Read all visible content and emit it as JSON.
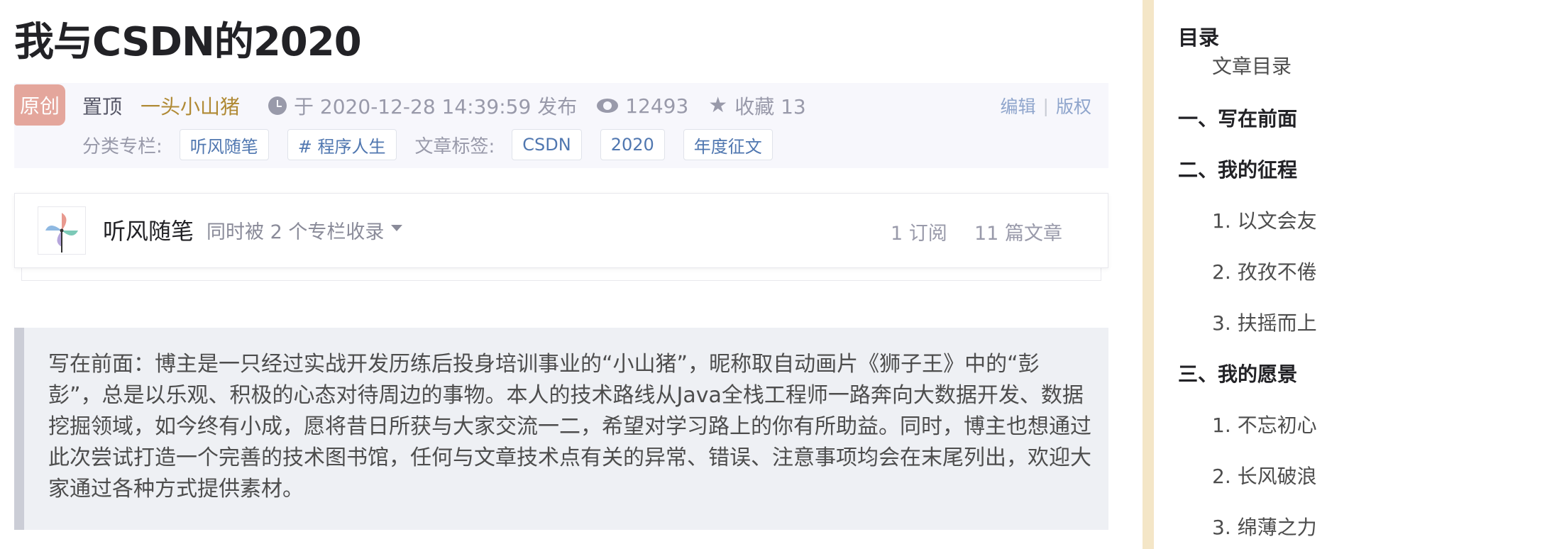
{
  "article": {
    "title": "我与CSDN的2020",
    "original_badge": "原创",
    "pinned": "置顶",
    "author": "一头小山猪",
    "publish_text": "于 2020-12-28 14:39:59 发布",
    "views": "12493",
    "favorites_text": "收藏 13",
    "edit_label": "编辑",
    "copyright_label": "版权",
    "category_label": "分类专栏:",
    "categories": [
      "听风随笔",
      "# 程序人生"
    ],
    "tags_label": "文章标签:",
    "tags": [
      "CSDN",
      "2020",
      "年度征文"
    ]
  },
  "column_card": {
    "name": "听风随笔",
    "also_included": "同时被 2 个专栏收录",
    "subscribers": "1 订阅",
    "article_count": "11 篇文章"
  },
  "quote": {
    "text": "写在前面：博主是一只经过实战开发历练后投身培训事业的“小山猪”，昵称取自动画片《狮子王》中的“彭彭”，总是以乐观、积极的心态对待周边的事物。本人的技术路线从Java全栈工程师一路奔向大数据开发、数据挖掘领域，如今终有小成，愿将昔日所获与大家交流一二，希望对学习路上的你有所助益。同时，博主也想通过此次尝试打造一个完善的技术图书馆，任何与文章技术点有关的异常、错误、注意事项均会在末尾列出，欢迎大家通过各种方式提供素材。"
  },
  "toc": {
    "title": "目录",
    "items": [
      "文章目录",
      "一、写在前面",
      "二、我的征程",
      "1. 以文会友",
      "2. 孜孜不倦",
      "3. 扶摇而上",
      "三、我的愿景",
      "1. 不忘初心",
      "2. 长风破浪",
      "3. 绵薄之力"
    ]
  },
  "colors": {
    "author": "#b08a35",
    "tag_text": "#5077b0",
    "badge_original": "#e4a69c",
    "sidebar_gutter": "#f4e6c7"
  }
}
